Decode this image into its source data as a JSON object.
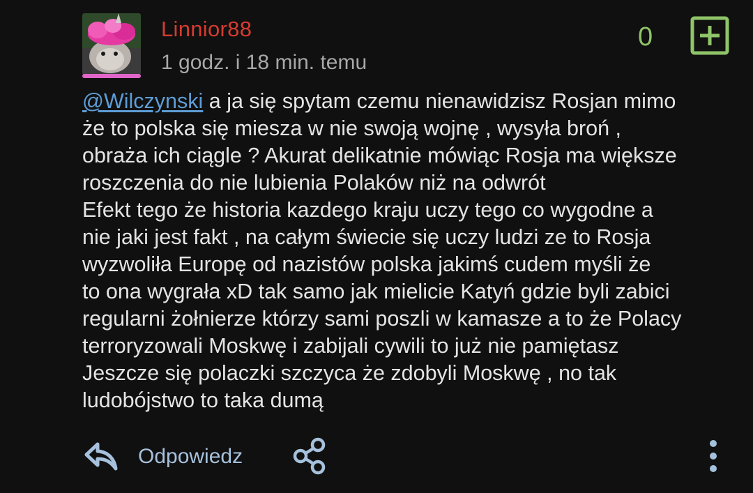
{
  "comment": {
    "username": "Linnior88",
    "timestamp": "1 godz. i 18 min. temu",
    "vote_count": "0",
    "mention": "@Wilczynski",
    "body_lines": [
      " a ja się spytam czemu nienawidzisz Rosjan mimo",
      "że to polska się miesza w nie swoją wojnę , wysyła broń ,",
      "obraża ich ciągle ? Akurat delikatnie mówiąc Rosja ma większe",
      "roszczenia do nie lubienia Polaków niż na odwrót",
      "Efekt tego że historia kazdego kraju uczy tego co wygodne a",
      "nie jaki jest fakt , na całym świecie się uczy ludzi ze to Rosja",
      "wyzwoliła Europę od nazistów polska jakimś cudem myśli że",
      "to ona wygrała xD tak samo jak mielicie Katyń gdzie byli zabici",
      "regularni żołnierze którzy sami poszli w kamasze a to że Polacy",
      "terroryzowali Moskwę i zabijali cywili to już nie pamiętasz",
      "Jeszcze się polaczki szczyca że zdobyli Moskwę , no tak",
      "ludobójstwo to taka dumą"
    ]
  },
  "actions": {
    "reply_label": "Odpowiedz",
    "reply_icon": "reply-arrow-icon",
    "share_icon": "share-icon",
    "more_icon": "more-vertical-icon",
    "plus_icon": "plus-box-icon"
  },
  "colors": {
    "background": "#101010",
    "username": "#d43c30",
    "timestamp": "#a8a8a8",
    "vote": "#8fc468",
    "mention": "#5e9dd6",
    "text": "#e4e4e4",
    "action": "#a6c1dc"
  }
}
